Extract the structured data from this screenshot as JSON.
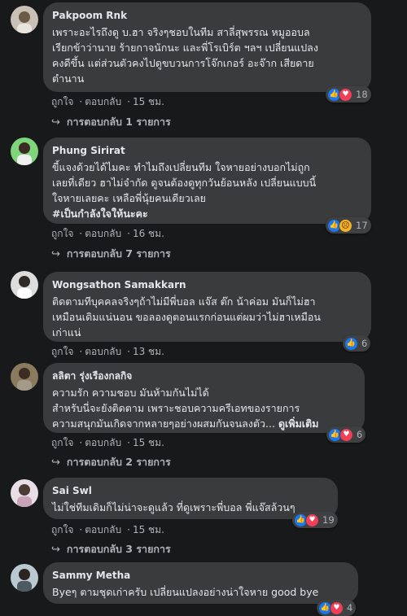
{
  "comments": [
    {
      "author": "Pakpoom Rnk",
      "text": "เพราะอะไรถึงดู บ.ฮา จริงๆชอบในทีม สาลี่สุพรรณ หมูออบล\nเรียกข้าว่านาย ร้ายกาจนักนะ และพี่โรเบิร์ต ฯลฯ เปลี่ยนแปลง\nคงดีขึ้น แต่ส่วนตัวคงไปดูขบวนการโจ๊กเกอร์ อะจ๊าก เสียดาย\nตำนาน",
      "like": "ถูกใจ",
      "reply": "ตอบกลับ",
      "time": "15 ชม.",
      "reaction_count": "18",
      "replies": "การตอบกลับ 1 รายการ"
    },
    {
      "author": "Phung Sirirat",
      "text": "ขี้แจงด้วยได้ไมคะ ทำไมถึงเปลี่ยนทีม ใจหายอย่างบอกไม่ถูก\nเลยที่เดียว ฮาไม่จำกัด ดูจนต้องดูทุกวันย้อนหลัง เปลี่ยนแบบนี้\nใจหายเลยคะ เหลือพี่นุ้ยคนเดียวเลย",
      "hashtag": "#เป็นกำลังใจให้นะคะ",
      "like": "ถูกใจ",
      "reply": "ตอบกลับ",
      "time": "16 ชม.",
      "reaction_count": "17",
      "replies": "การตอบกลับ 7 รายการ"
    },
    {
      "author": "Wongsathon Samakkarn",
      "text": "ติดตามทีบุคคลจริงๆถ้าไม่มีพี่บอล แจ๊ส ต๊ก น้าค่อม มันก็ไม่ฮา\nเหมือนเดิมแน่นอน ขอลองดูตอนแรกก่อนแต่ผมว่าไม่ฮาเหมือน\nเก่าแน่",
      "like": "ถูกใจ",
      "reply": "ตอบกลับ",
      "time": "13 ชม.",
      "reaction_count": "6"
    },
    {
      "author": "ลลิตา รุ่งเรืองกลกิจ",
      "text": "ความรัก ความชอบ มันห้ามกันไม่ได้\nสำหรับนี่จะยังติดตาม เพราะชอบความครีเอทของรายการ\nความสนุกมันเกิดจากหลายๆอย่างผสมกันจนลงตัว...",
      "see_more": "ดูเพิ่มเติม",
      "like": "ถูกใจ",
      "reply": "ตอบกลับ",
      "time": "15 ชม.",
      "reaction_count": "6",
      "replies": "การตอบกลับ 2 รายการ"
    },
    {
      "author": "Sai Swl",
      "text": "ไม่ใช่ทีมเดิมก็ไม่น่าจะดูแล้ว ที่ดูเพราะพี่บอล พี่แจ๊สล้วนๆ",
      "like": "ถูกใจ",
      "reply": "ตอบกลับ",
      "time": "15 ชม.",
      "reaction_count": "19",
      "replies": "การตอบกลับ 3 รายการ"
    },
    {
      "author": "Sammy Metha",
      "text": "Byeๆ ตามชุดเก่าครับ เปลี่ยนแปลงอย่างน่าใจหาย good bye",
      "reaction_count": "4"
    }
  ],
  "colors": {
    "background": "#18191a",
    "bubble": "#3a3b3c",
    "like": "#1877f2",
    "love": "#f33e58"
  }
}
